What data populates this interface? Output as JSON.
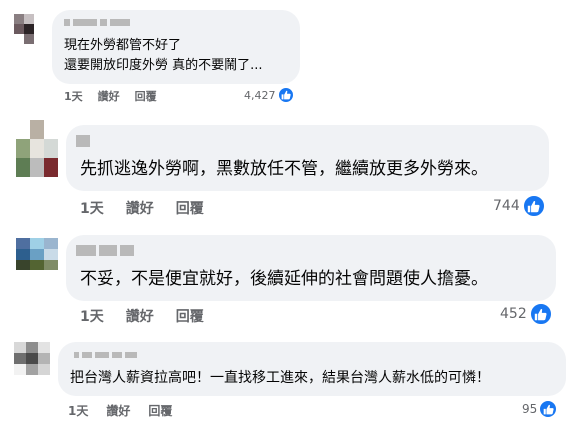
{
  "comments": [
    {
      "text": "現在外勞都管不好了\n還要開放印度外勞 真的不要鬧了...",
      "time": "1天",
      "like_label": "讚好",
      "reply_label": "回覆",
      "reaction_count": "4,427",
      "reaction_icon": "like-icon",
      "avatar_colors": [
        "#8a7f82",
        "#c7c0c2",
        "#ffffff",
        "#6b5a5f",
        "#2b2326",
        "#ffffff",
        "#ffffff",
        "#7a6e72",
        "#ffffff"
      ]
    },
    {
      "text": "先抓逃逸外勞啊，黑數放任不管，繼續放更多外勞來。",
      "time": "1天",
      "like_label": "讚好",
      "reply_label": "回覆",
      "reaction_count": "744",
      "reaction_icon": "like-icon",
      "avatar_colors": [
        "#ffffff",
        "#b9b0a4",
        "#ffffff",
        "#8fa37a",
        "#e7e4de",
        "#d4d9d6",
        "#5e7d54",
        "#bcbcbc",
        "#7a2a2e"
      ]
    },
    {
      "text": "不妥，不是便宜就好，後續延伸的社會問題使人擔憂。",
      "time": "1天",
      "like_label": "讚好",
      "reply_label": "回覆",
      "reaction_count": "452",
      "reaction_icon": "like-icon",
      "avatar_colors": [
        "#4f6fa0",
        "#9fd0e6",
        "#9ab5cf",
        "#2d5f8e",
        "#6aa0c4",
        "#c9dbe8",
        "#39442c",
        "#536432",
        "#7f8c67"
      ]
    },
    {
      "text": "把台灣人薪資拉高吧！一直找移工進來，結果台灣人薪水低的可憐！",
      "time": "1天",
      "like_label": "讚好",
      "reply_label": "回覆",
      "reaction_count": "95",
      "reaction_icon": "like-icon",
      "avatar_colors": [
        "#d8d8d8",
        "#8e8e8e",
        "#e3e3e3",
        "#6f6f6f",
        "#4a4a4a",
        "#b4b4b4",
        "#f2f2f2",
        "#a2a2a2",
        "#d5d5d5"
      ]
    }
  ]
}
